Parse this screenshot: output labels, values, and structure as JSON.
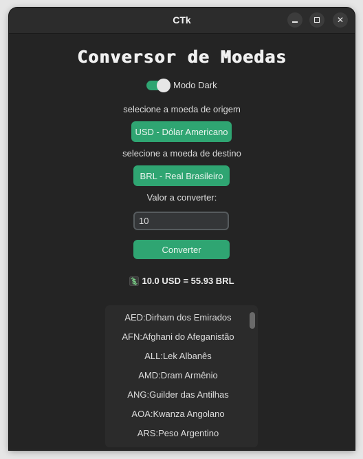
{
  "window": {
    "title": "CTk",
    "minimize_symbol": "",
    "maximize_symbol": "",
    "close_symbol": "✕"
  },
  "app": {
    "title": "Conversor de Moedas",
    "theme_switch": {
      "label": "Modo Dark",
      "on": true
    },
    "origin": {
      "label": "selecione a moeda de origem",
      "value": "USD - Dólar Americano"
    },
    "destination": {
      "label": "selecione a moeda de destino",
      "value": "BRL - Real Brasileiro"
    },
    "amount": {
      "label": "Valor a converter:",
      "value": "10"
    },
    "convert_button": "Converter",
    "result": {
      "icon": "currency-exchange-icon",
      "text": "10.0 USD = 55.93 BRL"
    },
    "currency_list": [
      "AED:Dirham dos Emirados",
      "AFN:Afghani do Afeganistão",
      "ALL:Lek Albanês",
      "AMD:Dram Armênio",
      "ANG:Guilder das Antilhas",
      "AOA:Kwanza Angolano",
      "ARS:Peso Argentino"
    ]
  },
  "colors": {
    "accent": "#2fa572",
    "background": "#242424",
    "titlebar": "#2c2c2c",
    "list_background": "#2b2b2b",
    "input_background": "#343638"
  }
}
